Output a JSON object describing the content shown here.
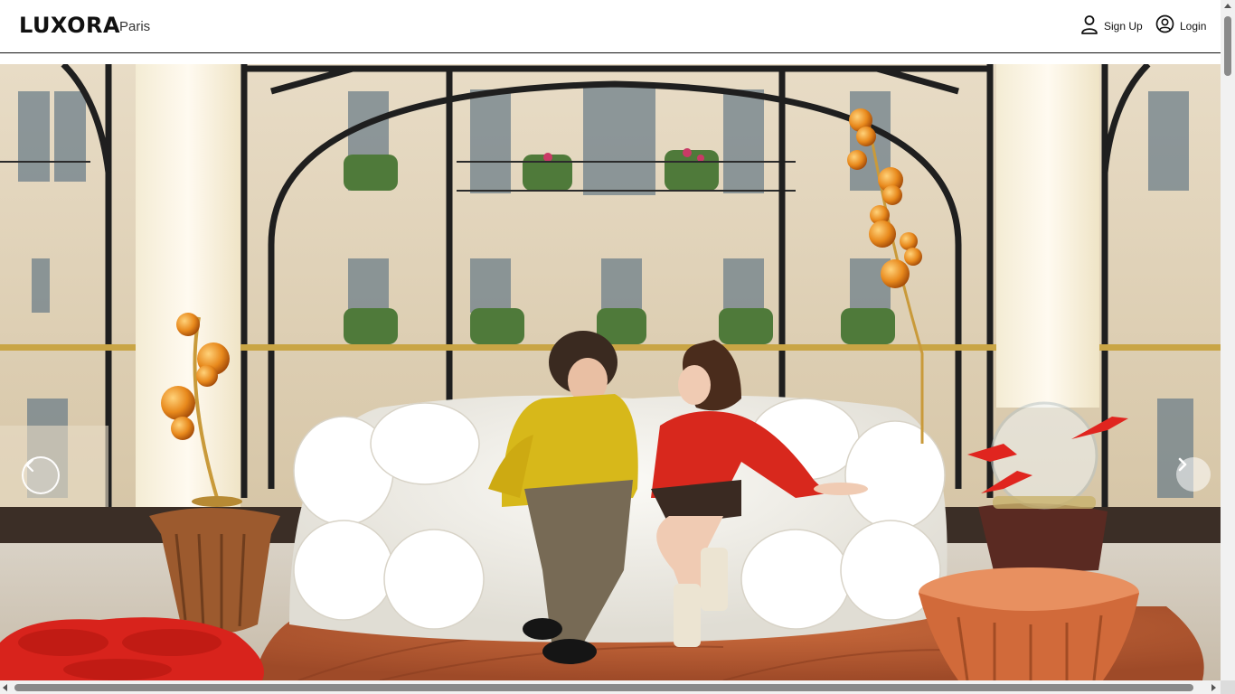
{
  "header": {
    "brand": "LUXORA",
    "city": "Paris",
    "signup_label": "Sign Up",
    "login_label": "Login",
    "signup_icon": "user-icon",
    "login_icon": "user-circle-icon"
  },
  "hero": {
    "image_alt": "Couple sitting on a white sofa in a Paris apartment with glass lamps",
    "prev_icon": "chevron-left-icon",
    "next_icon": "chevron-right-icon"
  },
  "colors": {
    "header_bg": "#ffffff",
    "text": "#111111",
    "accent_yellow": "#d7b81a",
    "accent_red": "#d8281d"
  }
}
